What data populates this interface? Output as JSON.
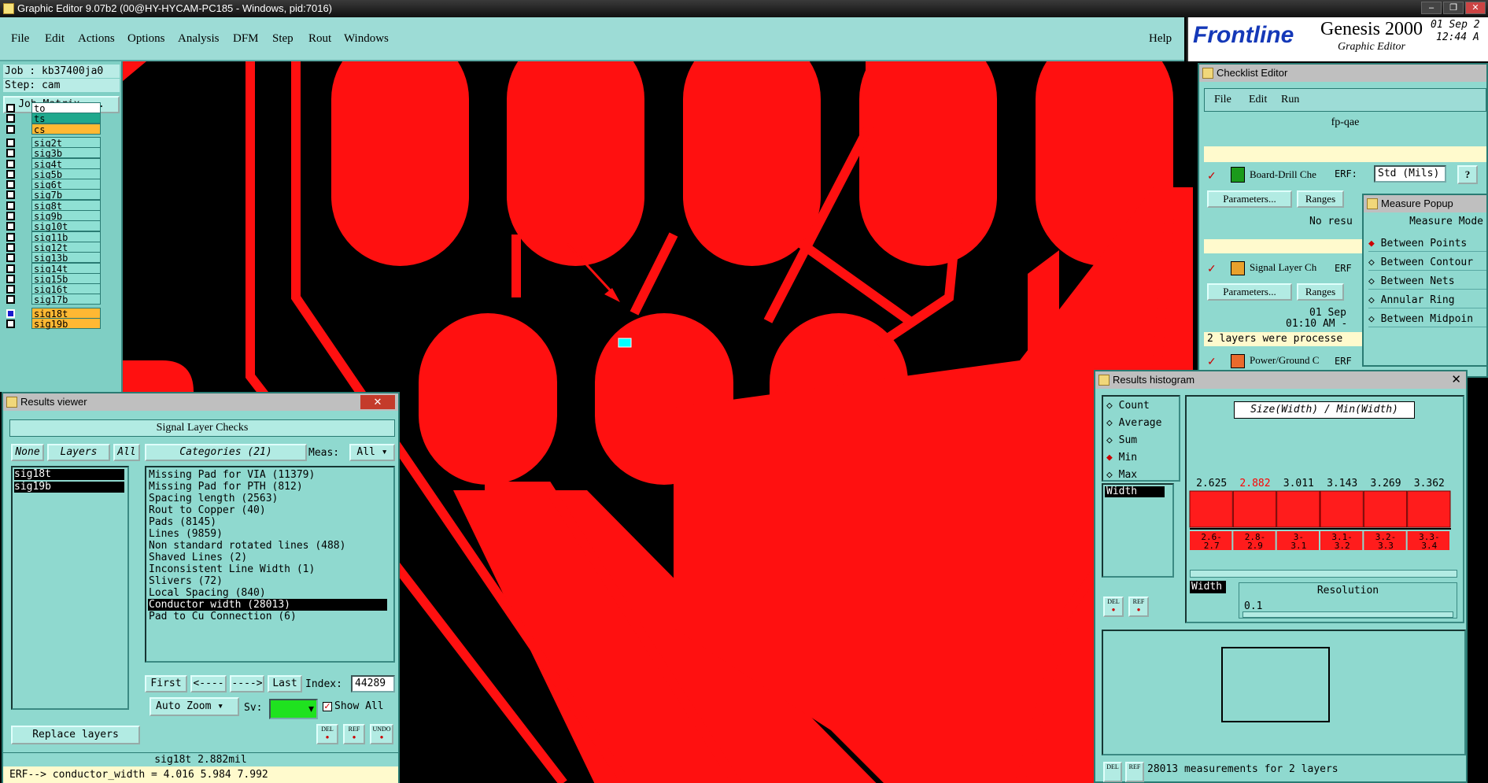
{
  "window": {
    "title": "Graphic Editor 9.07b2 (00@HY-HYCAM-PC185 - Windows, pid:7016)",
    "min": "–",
    "max": "❐",
    "close": "✕"
  },
  "menu": {
    "items": [
      "File",
      "Edit",
      "Actions",
      "Options",
      "Analysis",
      "DFM",
      "Step",
      "Rout",
      "Windows"
    ],
    "help": "Help"
  },
  "brand": {
    "logo": "Frontline",
    "product": "Genesis 2000",
    "subtitle": "Graphic Editor",
    "date": "01 Sep 2",
    "time": "12:44 A"
  },
  "left": {
    "job": "Job : kb37400ja0",
    "step": "Step: cam",
    "job_matrix": "Job Matrix ...",
    "layers": [
      "to",
      "ts",
      "cs",
      "sig2t",
      "sig3b",
      "sig4t",
      "sig5b",
      "sig6t",
      "sig7b",
      "sig8t",
      "sig9b",
      "sig10t",
      "sig11b",
      "sig12t",
      "sig13b",
      "sig14t",
      "sig15b",
      "sig16t",
      "sig17b",
      "sig18t",
      "sig19b"
    ]
  },
  "results_viewer": {
    "title": "Results viewer",
    "header": "Signal Layer Checks",
    "none_btn": "None",
    "layers_btn": "Layers",
    "all_btn": "All",
    "categories_btn": "Categories (21)",
    "meas_label": "Meas:",
    "meas_value": "All",
    "layers_list": [
      "sig18t",
      "sig19b"
    ],
    "categories": [
      "Missing Pad for VIA (11379)",
      "Missing Pad for PTH (812)",
      "Spacing length (2563)",
      "Rout to Copper (40)",
      "Pads (8145)",
      "Lines (9859)",
      "Non standard rotated lines (488)",
      "Shaved Lines (2)",
      "Inconsistent Line Width (1)",
      "Slivers (72)",
      "Local Spacing (840)",
      "Conductor width (28013)",
      "Pad to Cu Connection (6)"
    ],
    "selected_category": "Conductor width (28013)",
    "first": "First",
    "prev": "<----",
    "next": "---->",
    "last": "Last",
    "index_label": "Index:",
    "index_value": "44289",
    "auto_zoom": "Auto Zoom",
    "sv_label": "Sv:",
    "show_all": "Show All",
    "replace_layers": "Replace layers",
    "del": "DEL",
    "ref": "REF",
    "undo": "UNDO",
    "status": "sig18t 2.882mil",
    "erf": "ERF--> conductor_width = 4.016 5.984 7.992"
  },
  "checklist": {
    "title": "Checklist Editor",
    "menu": [
      "File",
      "Edit",
      "Run"
    ],
    "name": "fp-qae",
    "rows": [
      {
        "label": "Board-Drill Che",
        "erf": "ERF:",
        "erf_value": "Std (Mils)",
        "params": "Parameters...",
        "ranges": "Ranges",
        "result": "No resu"
      },
      {
        "label": "Signal Layer Ch",
        "erf": "ERF",
        "params": "Parameters...",
        "ranges": "Ranges",
        "date": "01 Sep",
        "time": "01:10 AM -",
        "note": "2 layers were processe"
      },
      {
        "label": "Power/Ground C",
        "erf": "ERF"
      }
    ]
  },
  "measure": {
    "title": "Measure Popup",
    "header": "Measure Mode",
    "modes": [
      "Between Points",
      "Between Contour",
      "Between Nets",
      "Annular Ring",
      "Between Midpoin"
    ],
    "selected": "Between Points"
  },
  "histogram": {
    "title": "Results histogram",
    "options": [
      "Count",
      "Average",
      "Sum",
      "Min",
      "Max"
    ],
    "selected": "Min",
    "axis_title": "Size(Width) / Min(Width)",
    "list_item": "Width",
    "bars": [
      {
        "bin": "2.6-2.7",
        "value": 2.625
      },
      {
        "bin": "2.8-2.9",
        "value": 2.882
      },
      {
        "bin": "3-3.1",
        "value": 3.011
      },
      {
        "bin": "3.1-3.2",
        "value": 3.143
      },
      {
        "bin": "3.2-3.3",
        "value": 3.269
      },
      {
        "bin": "3.3-3.4",
        "value": 3.362
      }
    ],
    "highlight_index": 1,
    "resolution_label": "Resolution",
    "resolution_value": "0.1",
    "width_tag": "Width",
    "del": "DEL",
    "ref": "REF",
    "status": "28013 measurements for 2 layers"
  },
  "colors": {
    "teal": "#8fd9cf",
    "copper": "#ff1010",
    "highlight": "#ffb833",
    "measure_marker": "#00ffff"
  }
}
